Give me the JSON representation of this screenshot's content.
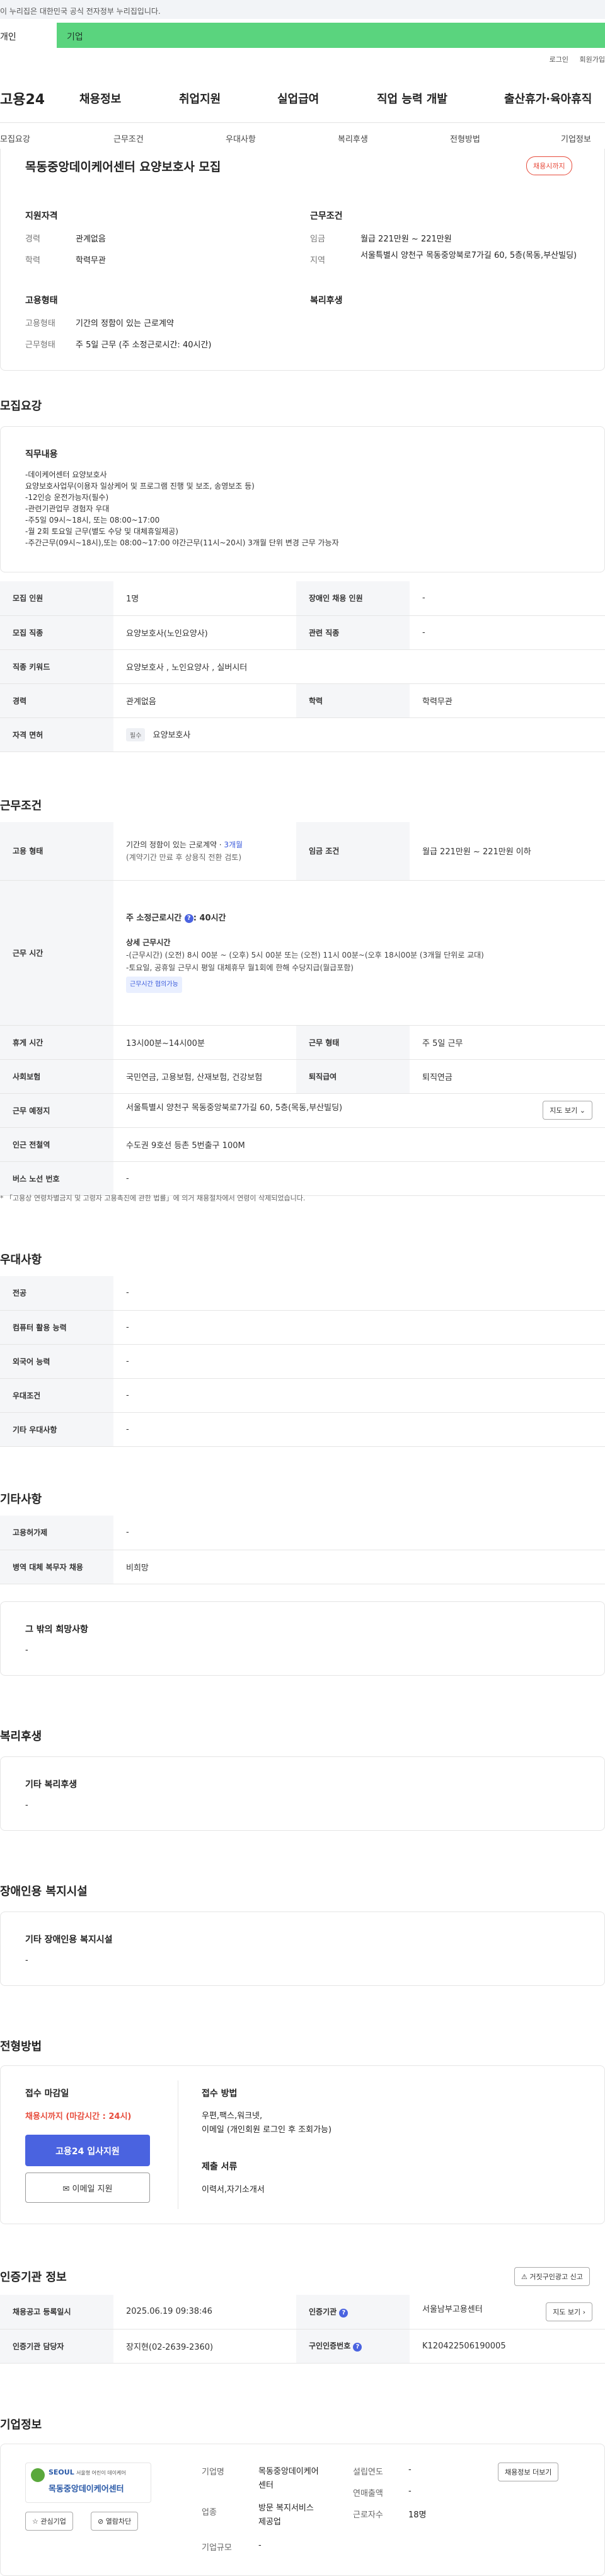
{
  "banner": {
    "text": "이 누리집은 대한민국 공식 전자정부 누리집입니다."
  },
  "tabs": {
    "individual": "개인",
    "business": "기업"
  },
  "util": {
    "login": "로그인",
    "signup": "회원가입"
  },
  "gnb": {
    "logo": "고용24",
    "items": [
      "채용정보",
      "취업지원",
      "실업급여",
      "직업 능력 개발",
      "출산휴가·육아휴직"
    ]
  },
  "subnav": {
    "items": [
      "모집요강",
      "근무조건",
      "우대사항",
      "복리후생",
      "전형방법",
      "기업정보"
    ]
  },
  "title": {
    "text": "목동중앙데이케어센터 요양보호사 모집",
    "badge": "채용시까지"
  },
  "summary": {
    "qual_h": "지원자격",
    "cond_h": "근무조건",
    "emp_h": "고용형태",
    "welfare_h": "복리후생",
    "career_k": "경력",
    "career_v": "관계없음",
    "edu_k": "학력",
    "edu_v": "학력무관",
    "wage_k": "임금",
    "wage_v": "월급 221만원 ~ 221만원",
    "region_k": "지역",
    "region_v": "서울특별시 양천구 목동중앙북로7가길 60, 5층(목동,부산빌딩)",
    "etype_k": "고용형태",
    "etype_v": "기간의 정함이 있는 근로계약",
    "wtype_k": "근무형태",
    "wtype_v": "주 5일 근무 (주 소정근로시간: 40시간)"
  },
  "recruit": {
    "heading": "모집요강",
    "duty_h": "직무내용",
    "duty_lines": [
      "-데이케어센터 요양보호사",
      "요양보호사업무(이용자 일상케어 및 프로그램 진행 및 보조, 송영보조 등)",
      "-12인승 운전가능자(필수)",
      "-관련기관업무 경험자 우대",
      "-주5일 09시~18시, 또는 08:00~17:00",
      "-월 2회 토요일 근무(별도 수당 및 대체휴일제공)",
      "-주간근무(09시~18시),또는 08:00~17:00 야간근무(11시~20시) 3개월 단위 변경 근무 가능자"
    ],
    "rows": [
      {
        "k1": "모집 인원",
        "v1": "1명",
        "k2": "장애인 채용 인원",
        "v2": "-"
      },
      {
        "k1": "모집 직종",
        "v1": "요양보호사(노인요양사)",
        "k2": "관련 직종",
        "v2": "-"
      },
      {
        "k1": "직종 키워드",
        "v1": "요양보호사 , 노인요양사 , 실버시터"
      },
      {
        "k1": "경력",
        "v1": "관계없음",
        "k2": "학력",
        "v2": "학력무관"
      },
      {
        "k1": "자격 면허",
        "tag": "필수",
        "v1": "요양보호사"
      }
    ]
  },
  "work": {
    "heading": "근무조건",
    "etype_k": "고용 형태",
    "etype_v1": "기간의 정함이 있는 근로계약 · ",
    "etype_v1b": "3개월",
    "etype_v2": "(계약기간 만료 후 상용직 전환 검토)",
    "wage_k": "임금 조건",
    "wage_v": "월급 221만원 ~ 221만원 이하",
    "hours_k": "근무 시간",
    "hours_title": "주 소정근로시간 ",
    "hours_title_b": ": 40시간",
    "hours_detail_h": "상세 근무시간",
    "hours_lines": [
      "-(근무시간) (오전) 8시 00분 ~ (오후) 5시 00분 또는 (오전) 11시 00분~(오후 18시00분 (3개월 단위로 교대)",
      "-토요일, 공휴일 근무시 평일 대체휴무 월1회에 한해 수당지급(월급포함)"
    ],
    "hours_tag": "근무시간 협의가능",
    "break_k": "휴게 시간",
    "break_v": "13시00분~14시00분",
    "wform_k": "근무 형태",
    "wform_v": "주 5일 근무",
    "ins_k": "사회보험",
    "ins_v": "국민연금, 고용보험, 산재보험, 건강보험",
    "ret_k": "퇴직급여",
    "ret_v": "퇴직연금",
    "loc_k": "근무 예정지",
    "loc_v": "서울특별시 양천구 목동중앙북로7가길 60, 5층(목동,부산빌딩)",
    "map_btn": "지도 보기",
    "subway_k": "인근 전철역",
    "subway_v": "수도권 9호선 등촌 5번출구 100M",
    "bus_k": "버스 노선 번호",
    "bus_v": "-",
    "note": "* 「고용상 연령차별금지 및 고령자 고용촉진에 관한 법률」에 의거 채용절차에서 연령이 삭제되었습니다."
  },
  "pref": {
    "heading": "우대사항",
    "rows": [
      {
        "k": "전공",
        "v": "-"
      },
      {
        "k": "컴퓨터 활용 능력",
        "v": "-"
      },
      {
        "k": "외국어 능력",
        "v": "-"
      },
      {
        "k": "우대조건",
        "v": "-"
      },
      {
        "k": "기타 우대사항",
        "v": "-"
      }
    ]
  },
  "etc": {
    "heading": "기타사항",
    "rows": [
      {
        "k": "고용허가제",
        "v": "-"
      },
      {
        "k": "병역 대체 복무자 채용",
        "v": "비희망"
      }
    ],
    "other_h": "그 밖의 희망사항",
    "other_v": "-"
  },
  "welfare": {
    "heading": "복리후생",
    "box_h": "기타 복리후생",
    "box_v": "-"
  },
  "disabled": {
    "heading": "장애인용 복지시설",
    "box_h": "기타 장애인용 복지시설",
    "box_v": "-"
  },
  "process": {
    "heading": "전형방법",
    "deadline_h": "접수 마감일",
    "deadline_v": "채용시까지 (마감시간 : 24시)",
    "apply_btn": "고용24 입사지원",
    "email_btn": "이메일 지원",
    "method_h": "접수 방법",
    "method_v1": "우편,팩스,워크넷,",
    "method_v2": "이메일 (개인회원 로그인 후 조회가능)",
    "docs_h": "제출 서류",
    "docs_v": "이력서,자기소개서"
  },
  "cert": {
    "heading": "인증기관 정보",
    "report_btn": "거짓구인광고 신고",
    "rows": [
      {
        "k1": "채용공고 등록일시",
        "v1": "2025.06.19 09:38:46",
        "k2": "인증기관",
        "v2": "서울남부고용센터",
        "btn": "지도 보기"
      },
      {
        "k1": "인증기관 담당자",
        "v1": "장지현(02-2639-2360)",
        "k2": "구인인증번호",
        "v2": "K120422506190005"
      }
    ]
  },
  "company": {
    "heading": "기업정보",
    "logo_seoul": "SEOUL",
    "logo_small": "서울형 어린이 데이케어",
    "logo_name": "목동중앙데이케어센터",
    "fav_btn": "관심기업",
    "block_btn": "열람차단",
    "name_k": "기업명",
    "name_v1": "목동중앙데이케어",
    "name_v2": "센터",
    "ind_k": "업종",
    "ind_v1": "방문 복지서비스",
    "ind_v2": "제공업",
    "size_k": "기업규모",
    "size_v": "-",
    "est_k": "설립연도",
    "est_v": "-",
    "rev_k": "연매출액",
    "rev_v": "-",
    "emp_k": "근로자수",
    "emp_v": "18명",
    "info_btn": "채용정보 더보기"
  }
}
